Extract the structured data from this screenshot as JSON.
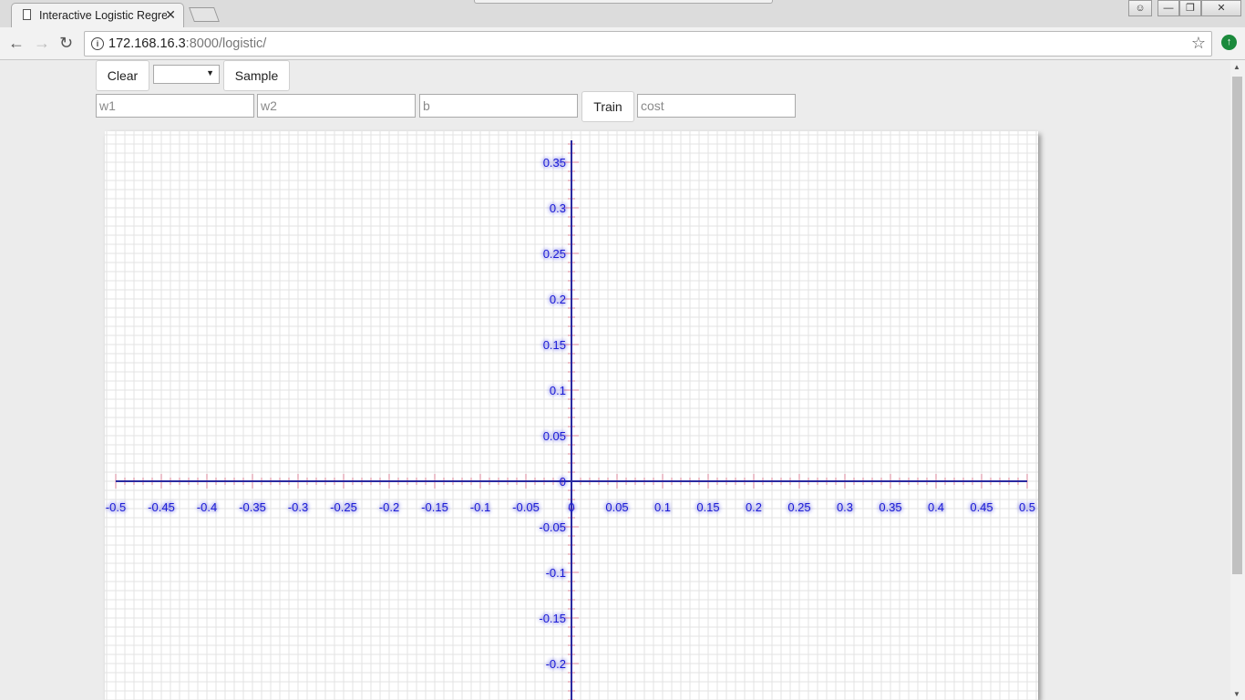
{
  "browser": {
    "tab_title": "Interactive Logistic Regression",
    "url_host": "172.168.16.3",
    "url_rest": ":8000/logistic/"
  },
  "controls": {
    "clear_label": "Clear",
    "select_value": "",
    "sample_label": "Sample",
    "train_label": "Train",
    "w1_placeholder": "w1",
    "w2_placeholder": "w2",
    "b_placeholder": "b",
    "cost_placeholder": "cost"
  },
  "chart_data": {
    "type": "scatter",
    "title": "",
    "xlabel": "",
    "ylabel": "",
    "xlim": [
      -0.5,
      0.5
    ],
    "ylim": [
      -0.2,
      0.35
    ],
    "x_ticks": [
      "-0.5",
      "-0.45",
      "-0.4",
      "-0.35",
      "-0.3",
      "-0.25",
      "-0.2",
      "-0.15",
      "-0.1",
      "-0.05",
      "0",
      "0.05",
      "0.1",
      "0.15",
      "0.2",
      "0.25",
      "0.3",
      "0.35",
      "0.4",
      "0.45",
      "0.5"
    ],
    "y_ticks": [
      "0.35",
      "0.3",
      "0.25",
      "0.2",
      "0.15",
      "0.1",
      "0.05",
      "0",
      "-0.05",
      "-0.1",
      "-0.15",
      "-0.2"
    ],
    "points": [],
    "grid": true,
    "colors": {
      "axis": "#2a2aa0",
      "tick": "#d9849a",
      "label": "#1a1ad6",
      "grid": "#e3e3e3"
    }
  }
}
